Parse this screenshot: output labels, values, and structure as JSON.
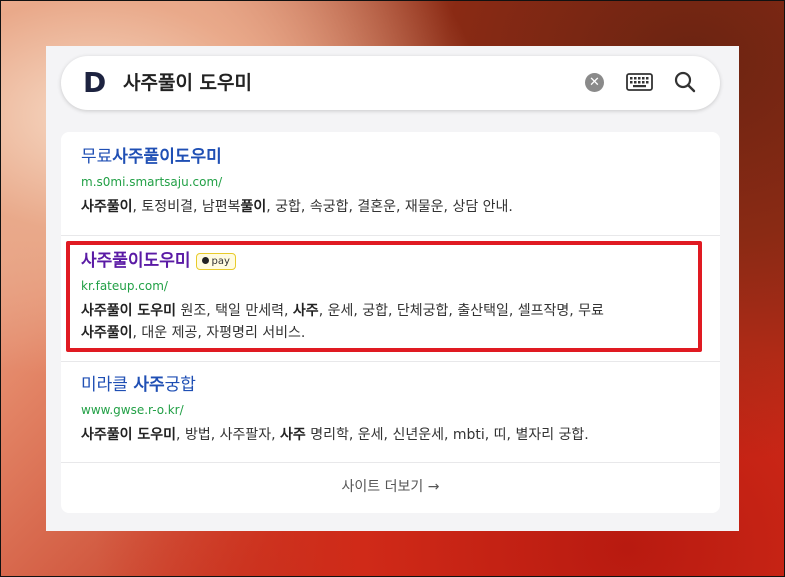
{
  "search": {
    "logo": "D",
    "query": "사주풀이 도우미"
  },
  "results": [
    {
      "title_pre": "무료",
      "title_bold": "사주풀이도우미",
      "url": "m.s0mi.smartsaju.com/",
      "desc_bold1": "사주풀이",
      "desc_rest1": ", 토정비결, 남편복",
      "desc_bold2": "풀이",
      "desc_rest2": ", 궁합, 속궁합, 결혼운, 재물운, 상담 안내."
    },
    {
      "title": "사주풀이도우미",
      "badge": "pay",
      "url": "kr.fateup.com/",
      "desc_bold1": "사주풀이 도우미",
      "desc_rest1": " 원조, 택일 만세력, ",
      "desc_bold2": "사주",
      "desc_rest2": ", 운세, 궁합, 단체궁합, 출산택일, 셀프작명, 무료",
      "desc_bold3": "사주풀이",
      "desc_rest3": ", 대운 제공, 자평명리 서비스."
    },
    {
      "title_pre": "미라클 ",
      "title_bold": "사주",
      "title_post": "궁합",
      "url": "www.gwse.r-o.kr/",
      "desc_bold1": "사주풀이 도우미",
      "desc_rest1": ", 방법, 사주팔자, ",
      "desc_bold2": "사주",
      "desc_rest2": " 명리학, 운세, 신년운세, mbti, 띠, 별자리 궁합."
    }
  ],
  "more_label": "사이트 더보기 →",
  "colors": {
    "highlight": "#e01a22",
    "link": "#1f4fb4",
    "visited": "#5a1aa5",
    "url": "#22a046"
  }
}
